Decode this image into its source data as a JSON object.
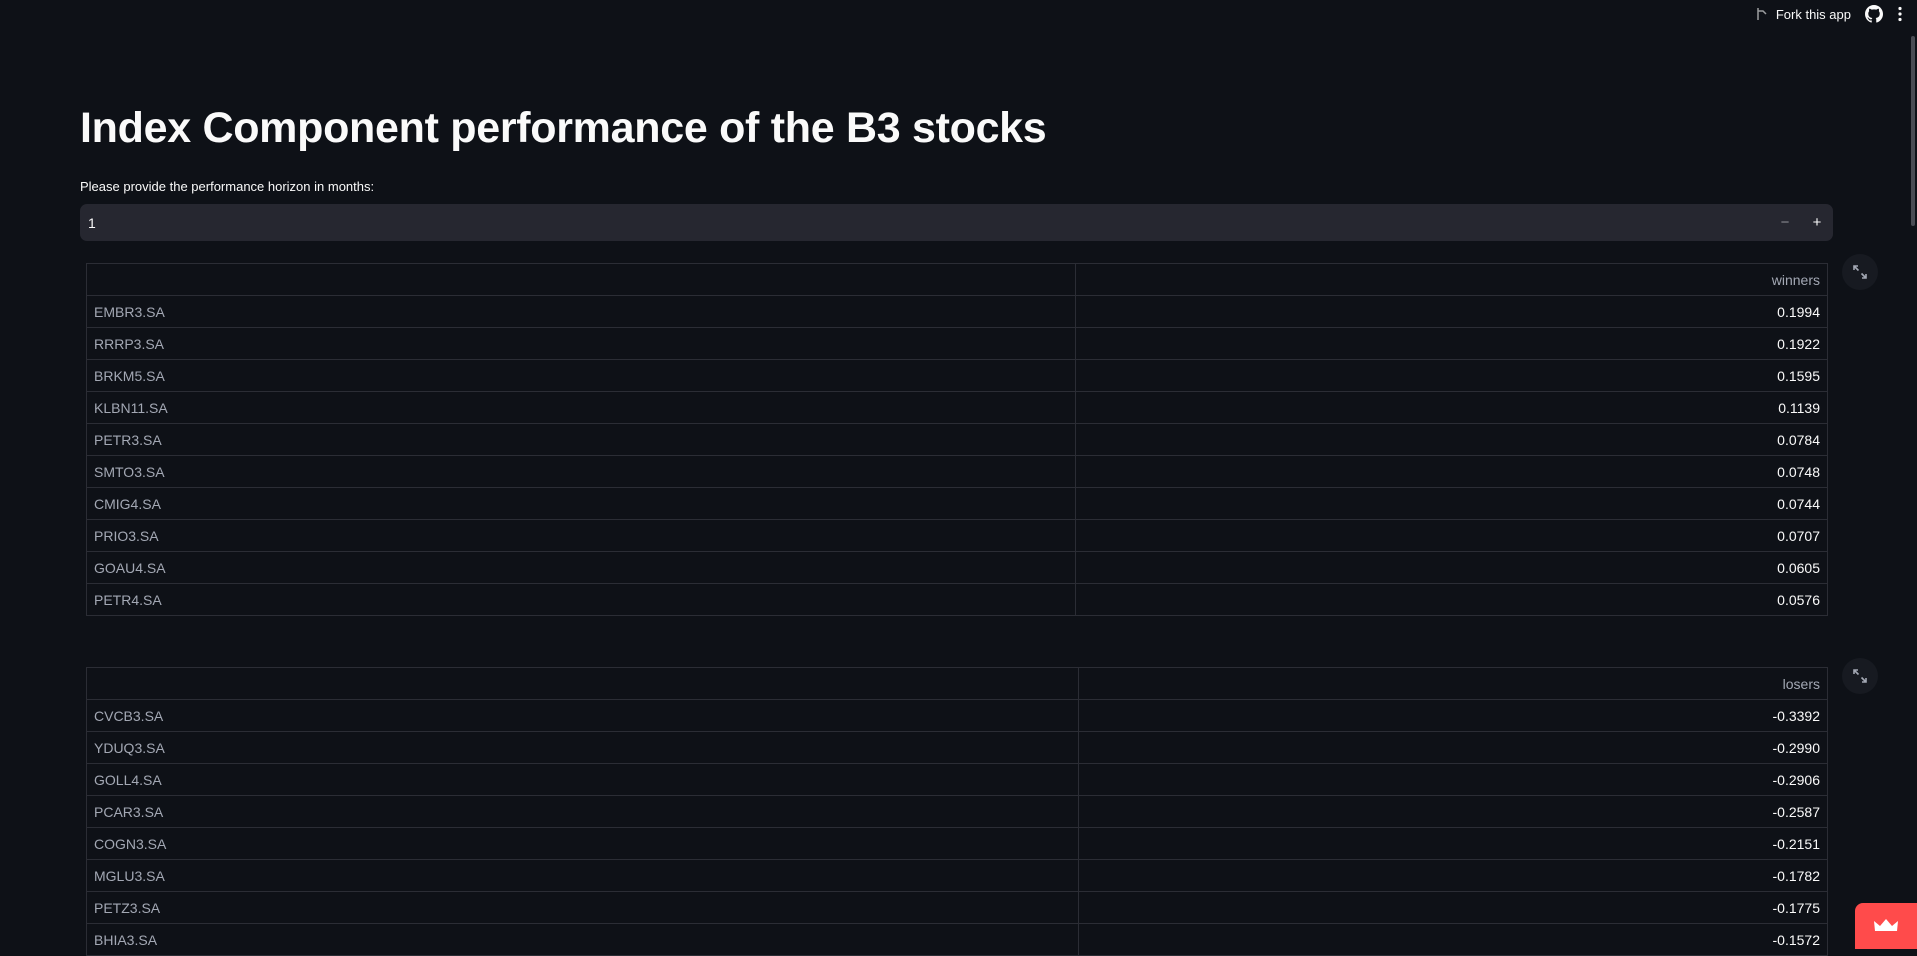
{
  "header": {
    "fork_label": "Fork this app",
    "fork_icon": "fork-icon",
    "github_icon": "github-icon",
    "menu_icon": "kebab-menu-icon"
  },
  "page": {
    "title": "Index Component performance of the B3 stocks",
    "input_label": "Please provide the performance horizon in months:",
    "input_value": "1",
    "minus_label": "−",
    "plus_label": "+"
  },
  "winners": {
    "index_header": "",
    "column_header": "winners",
    "rows": [
      {
        "ticker": "EMBR3.SA",
        "value": "0.1994"
      },
      {
        "ticker": "RRRP3.SA",
        "value": "0.1922"
      },
      {
        "ticker": "BRKM5.SA",
        "value": "0.1595"
      },
      {
        "ticker": "KLBN11.SA",
        "value": "0.1139"
      },
      {
        "ticker": "PETR3.SA",
        "value": "0.0784"
      },
      {
        "ticker": "SMTO3.SA",
        "value": "0.0748"
      },
      {
        "ticker": "CMIG4.SA",
        "value": "0.0744"
      },
      {
        "ticker": "PRIO3.SA",
        "value": "0.0707"
      },
      {
        "ticker": "GOAU4.SA",
        "value": "0.0605"
      },
      {
        "ticker": "PETR4.SA",
        "value": "0.0576"
      }
    ]
  },
  "losers": {
    "index_header": "",
    "column_header": "losers",
    "rows": [
      {
        "ticker": "CVCB3.SA",
        "value": "-0.3392"
      },
      {
        "ticker": "YDUQ3.SA",
        "value": "-0.2990"
      },
      {
        "ticker": "GOLL4.SA",
        "value": "-0.2906"
      },
      {
        "ticker": "PCAR3.SA",
        "value": "-0.2587"
      },
      {
        "ticker": "COGN3.SA",
        "value": "-0.2151"
      },
      {
        "ticker": "MGLU3.SA",
        "value": "-0.1782"
      },
      {
        "ticker": "PETZ3.SA",
        "value": "-0.1775"
      },
      {
        "ticker": "BHIA3.SA",
        "value": "-0.1572"
      }
    ]
  },
  "colors": {
    "background": "#0e1117",
    "input_bg": "#262730",
    "border": "#2b2d35",
    "accent": "#ff4b4b"
  }
}
